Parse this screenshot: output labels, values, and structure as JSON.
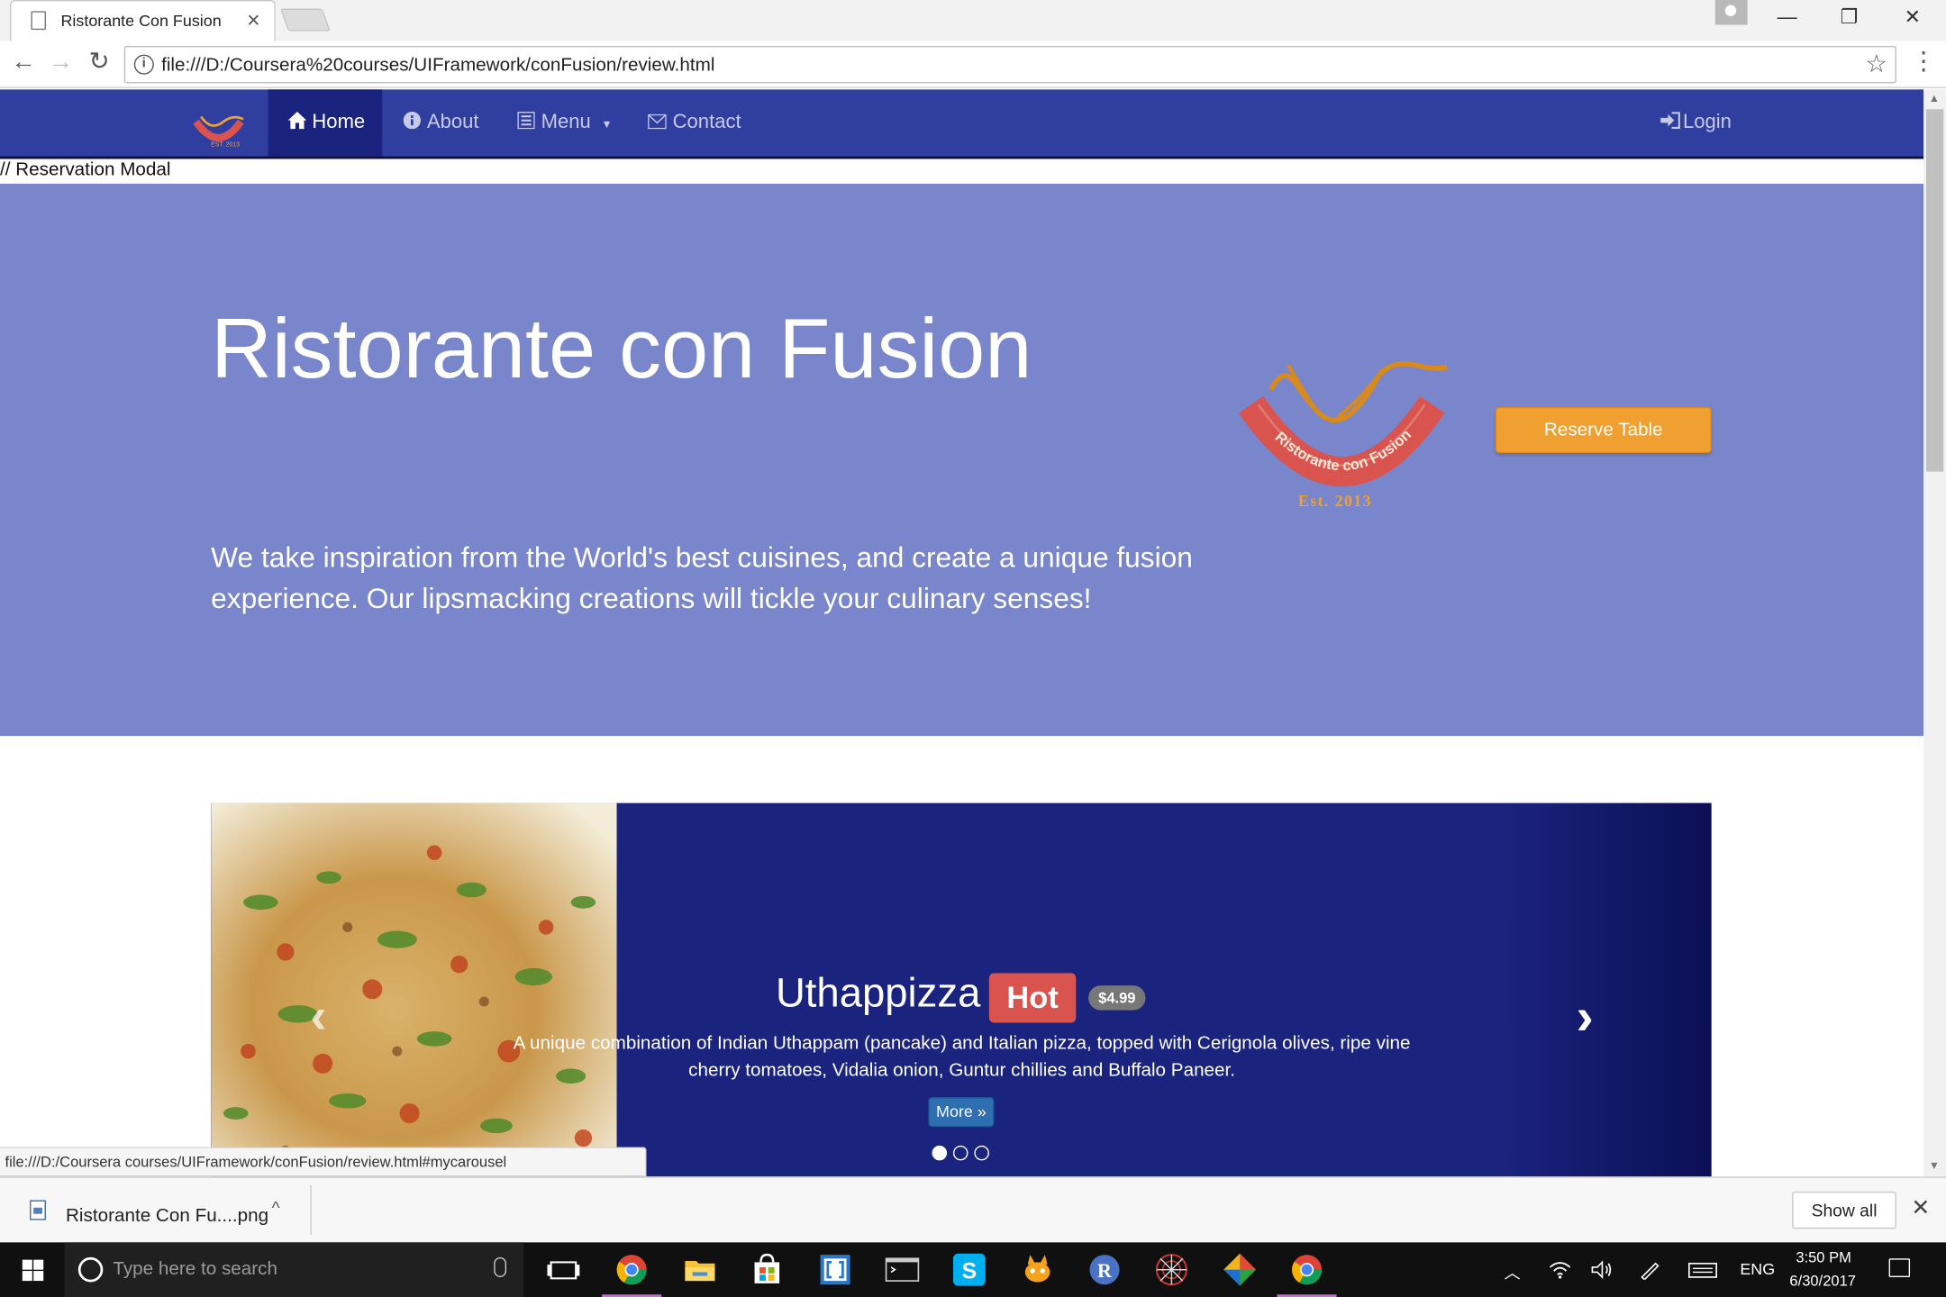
{
  "browser": {
    "tab_title": "Ristorante Con Fusion",
    "tab_close": "×",
    "url": "file:///D:/Coursera%20courses/UIFramework/conFusion/review.html",
    "window_controls": {
      "minimize": "—",
      "restore": "❐",
      "close": "✕"
    },
    "nav": {
      "back": "←",
      "forward": "→",
      "reload": "↻"
    },
    "info": "i",
    "star": "☆",
    "menu": "⋮"
  },
  "site": {
    "navbar": {
      "items": [
        {
          "label": "Home",
          "icon": "home-icon"
        },
        {
          "label": "About",
          "icon": "info-icon"
        },
        {
          "label": "Menu",
          "icon": "list-icon"
        },
        {
          "label": "Contact",
          "icon": "envelope-icon"
        }
      ],
      "login": "Login",
      "colors": {
        "navbar": "#303f9f",
        "active": "#1a237e"
      }
    },
    "reservation_comment": "// Reservation Modal",
    "jumbotron": {
      "title": "Ristorante con Fusion",
      "text": "We take inspiration from the World's best cuisines, and create a unique fusion experience. Our lipsmacking creations will tickle your culinary senses!",
      "logo_text": "Ristorante con Fusion",
      "logo_est": "Est. 2013",
      "reserve_button": "Reserve Table",
      "background": "#7986cb"
    },
    "carousel": {
      "title": "Uthappizza",
      "badge": "Hot",
      "price": "$4.99",
      "description": "A unique combination of Indian Uthappam (pancake) and Italian pizza, topped with Cerignola olives, ripe vine cherry tomatoes, Vidalia onion, Guntur chillies and Buffalo Paneer.",
      "more_button": "More »",
      "prev": "‹",
      "next": "›",
      "active_slide": 1,
      "slide_count": 3
    }
  },
  "status_url": "file:///D:/Coursera courses/UIFramework/conFusion/review.html#mycarousel",
  "downloads": {
    "file_name": "Ristorante Con Fu....png",
    "caret": "^",
    "show_all": "Show all",
    "close": "✕"
  },
  "taskbar": {
    "search_placeholder": "Type here to search",
    "language": "ENG",
    "time": "3:50 PM",
    "date": "6/30/2017",
    "apps": [
      "task-view-icon",
      "chrome-icon",
      "file-explorer-icon",
      "store-icon",
      "brackets-icon",
      "terminal-icon",
      "skype-icon",
      "scratch-cat-icon",
      "r-icon",
      "spider-web-icon",
      "git-icon",
      "chrome-active-icon"
    ]
  }
}
